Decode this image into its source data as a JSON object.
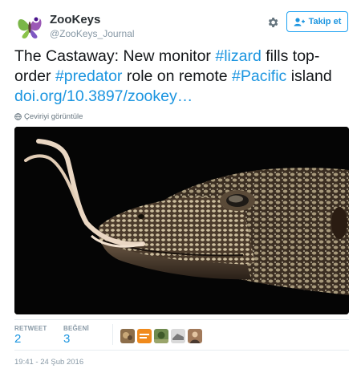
{
  "account": {
    "name": "ZooKeys",
    "handle": "@ZooKeys_Journal",
    "avatar_icon": "butterfly-logo-icon"
  },
  "header": {
    "settings_icon": "gear-icon",
    "follow_label": "Takip et",
    "follow_icon": "add-user-icon"
  },
  "tweet": {
    "t1": "The Castaway: New monitor ",
    "tag1": "#lizard",
    "t2": " fills top-order ",
    "tag2": "#predator",
    "t3": " role on remote ",
    "tag3": "#Pacific",
    "t4": " island ",
    "link": "doi.org/10.3897/zookey…"
  },
  "translate": {
    "label": "Çeviriyi görüntüle",
    "icon": "globe-icon"
  },
  "media": {
    "icon": "lizard-photo"
  },
  "stats": {
    "retweet_label": "RETWEET",
    "retweet_count": "2",
    "like_label": "BEĞENİ",
    "like_count": "3"
  },
  "likers": [
    "user-avatar-1",
    "user-avatar-2",
    "user-avatar-3",
    "user-avatar-4",
    "user-avatar-5"
  ],
  "timestamp": "19:41 - 24 Şub 2016",
  "colors": {
    "link": "#1b95e0",
    "follow_border": "#1da1f2",
    "muted": "#8899a6",
    "text": "#14171a"
  }
}
